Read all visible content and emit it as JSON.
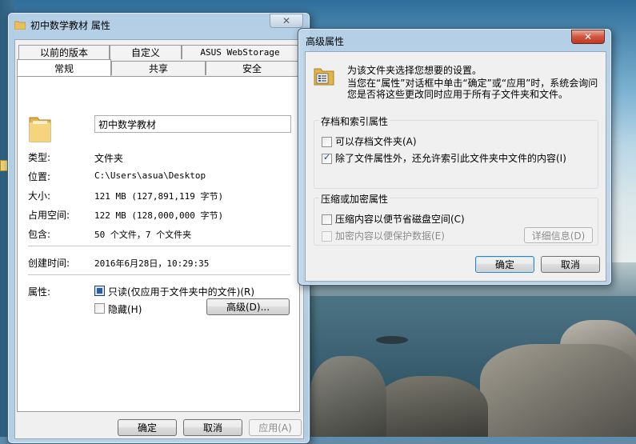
{
  "props_window": {
    "title": "初中数学教材 属性",
    "tabs_row1": [
      "以前的版本",
      "自定义",
      "ASUS WebStorage"
    ],
    "tabs_row2": [
      "常规",
      "共享",
      "安全"
    ],
    "folder_name": "初中数学教材",
    "rows": [
      {
        "label": "类型:",
        "value": "文件夹"
      },
      {
        "label": "位置:",
        "value": "C:\\Users\\asua\\Desktop"
      },
      {
        "label": "大小:",
        "value": "121 MB (127,891,119 字节)"
      },
      {
        "label": "占用空间:",
        "value": "122 MB (128,000,000 字节)"
      },
      {
        "label": "包含:",
        "value": "50 个文件，7 个文件夹"
      }
    ],
    "created": {
      "label": "创建时间:",
      "value": "2016年6月28日，10:29:35"
    },
    "attributes": {
      "label": "属性:",
      "readonly": "只读(仅应用于文件夹中的文件)(R)",
      "hidden": "隐藏(H)",
      "advanced_button": "高级(D)..."
    },
    "buttons": {
      "ok": "确定",
      "cancel": "取消",
      "apply": "应用(A)"
    }
  },
  "adv_dialog": {
    "title": "高级属性",
    "intro_line1": "为该文件夹选择您想要的设置。",
    "intro_line2": "当您在“属性”对话框中单击“确定”或“应用”时，系统会询问您是否将这些更改同时应用于所有子文件夹和文件。",
    "archive_group": {
      "title": "存档和索引属性",
      "archive": "可以存档文件夹(A)",
      "index": "除了文件属性外，还允许索引此文件夹中文件的内容(I)"
    },
    "compress_group": {
      "title": "压缩或加密属性",
      "compress": "压缩内容以便节省磁盘空间(C)",
      "encrypt": "加密内容以便保护数据(E)",
      "details_button": "详细信息(D)"
    },
    "buttons": {
      "ok": "确定",
      "cancel": "取消"
    }
  },
  "icons": [
    "folder-icon",
    "close-icon",
    "attributes-icon",
    "checkbox-checked",
    "checkbox-unchecked"
  ]
}
